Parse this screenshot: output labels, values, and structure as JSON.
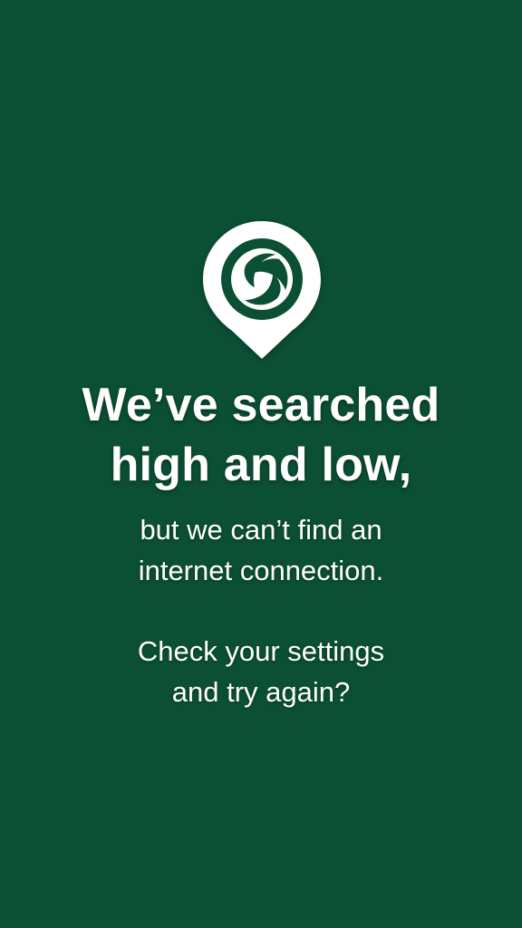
{
  "logo": {
    "icon": "location-pin-logo-icon",
    "pin_color": "#ffffff",
    "mark_color": "#0b4f34"
  },
  "colors": {
    "background": "#0b4f34",
    "text": "#ffffff"
  },
  "headline": {
    "line1": "We’ve searched",
    "line2": "high and low,"
  },
  "message": {
    "line1": "but we can’t find an",
    "line2": "internet connection."
  },
  "prompt": {
    "line1": "Check your settings",
    "line2": "and try again?"
  }
}
